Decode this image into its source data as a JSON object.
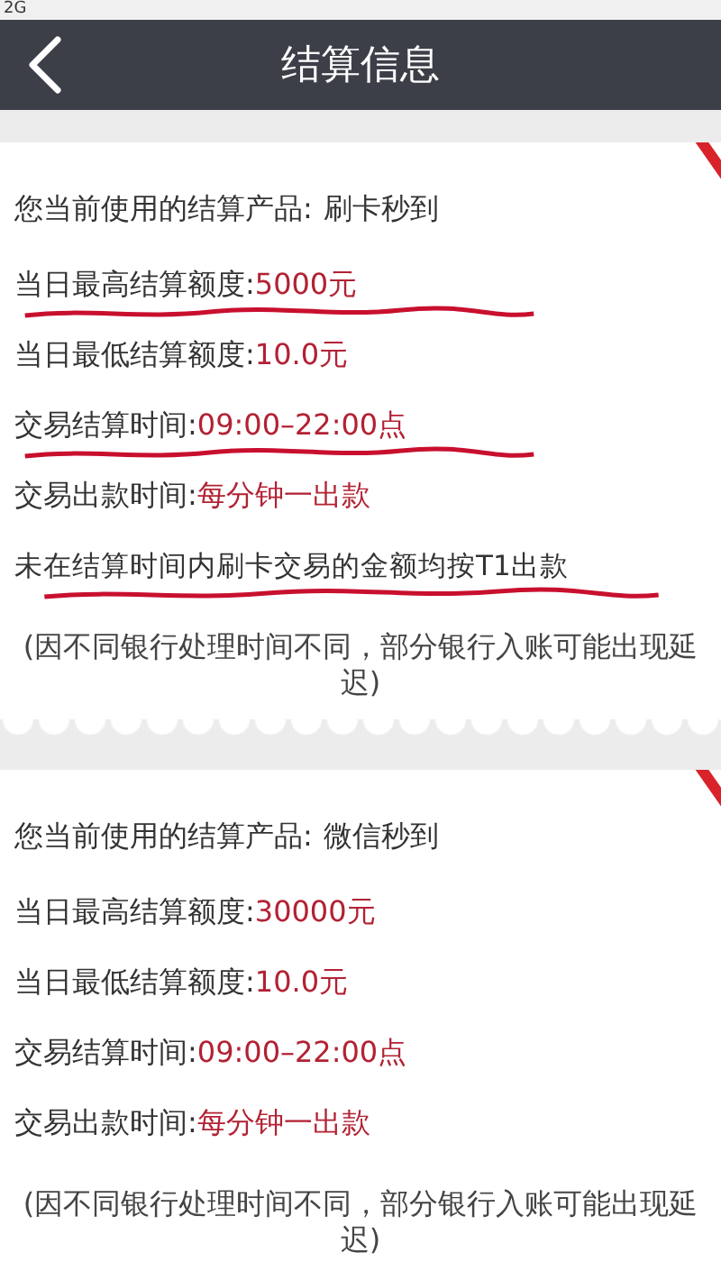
{
  "status_bar": {
    "network": "2G"
  },
  "header": {
    "title": "结算信息"
  },
  "cards": [
    {
      "rows": [
        {
          "kind": "product",
          "label": "您当前使用的结算产品:",
          "value": "刷卡秒到",
          "underlined": false
        },
        {
          "kind": "field",
          "label": "当日最高结算额度:",
          "value": "5000元",
          "underlined": true
        },
        {
          "kind": "field",
          "label": "当日最低结算额度:",
          "value": "10.0元",
          "underlined": false
        },
        {
          "kind": "field",
          "label": "交易结算时间:",
          "value": "09:00–22:00点",
          "underlined": true
        },
        {
          "kind": "field",
          "label": "交易出款时间:",
          "value": "每分钟一出款",
          "underlined": false
        },
        {
          "kind": "note",
          "label": "未在结算时间内刷卡交易的金额均按T1出款",
          "underlined": true
        }
      ],
      "footnote": "(因不同银行处理时间不同，部分银行入账可能出现延迟)"
    },
    {
      "rows": [
        {
          "kind": "product",
          "label": "您当前使用的结算产品:",
          "value": "微信秒到",
          "underlined": false
        },
        {
          "kind": "field",
          "label": "当日最高结算额度:",
          "value": "30000元",
          "underlined": false
        },
        {
          "kind": "field",
          "label": "当日最低结算额度:",
          "value": "10.0元",
          "underlined": false
        },
        {
          "kind": "field",
          "label": "交易结算时间:",
          "value": "09:00–22:00点",
          "underlined": false
        },
        {
          "kind": "field",
          "label": "交易出款时间:",
          "value": "每分钟一出款",
          "underlined": false
        }
      ],
      "footnote": "(因不同银行处理时间不同，部分银行入账可能出现延迟)"
    }
  ]
}
